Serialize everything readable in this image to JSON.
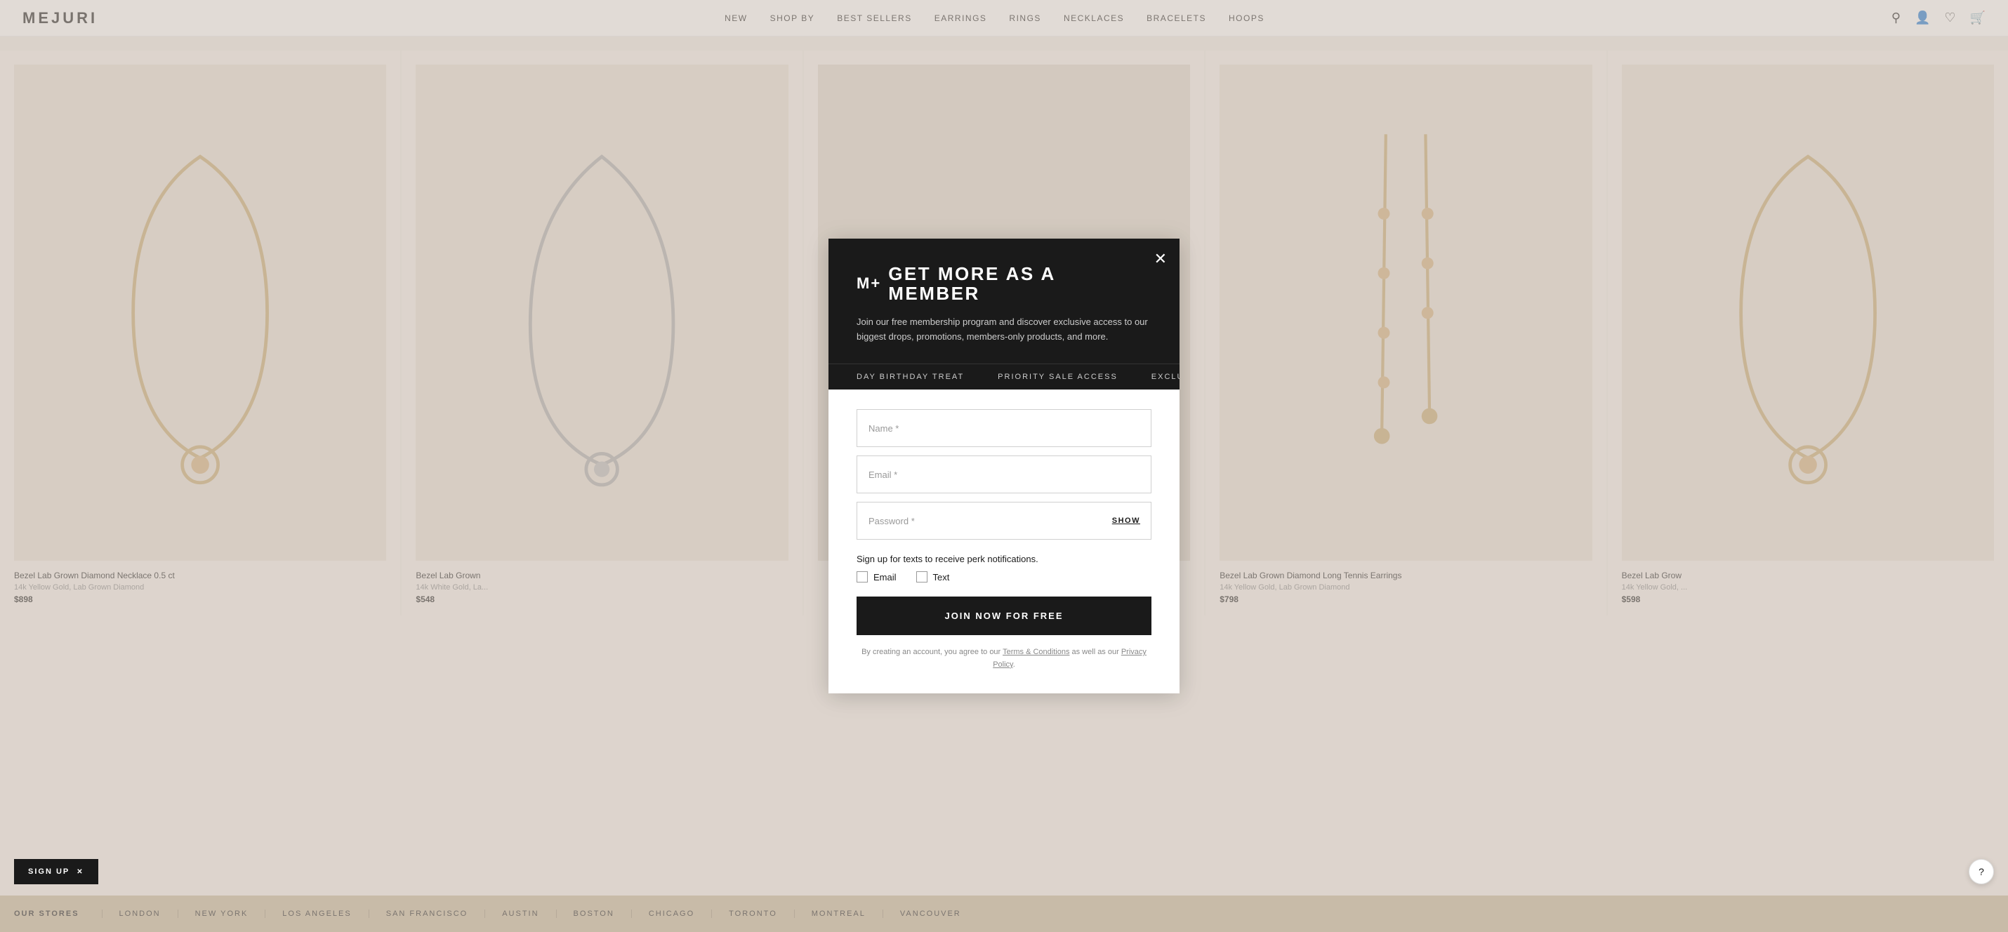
{
  "brand": {
    "logo": "MEJURI"
  },
  "nav": {
    "links": [
      "NEW",
      "SHOP BY",
      "BEST SELLERS",
      "EARRINGS",
      "RINGS",
      "NECKLACES",
      "BRACELETS",
      "HOOPS"
    ]
  },
  "modal": {
    "mplus": "M+",
    "title": "GET MORE AS A MEMBER",
    "subtitle": "Join our free membership program and discover exclusive access to our biggest drops, promotions, members-only products, and more.",
    "perks": [
      "DAY BIRTHDAY TREAT",
      "PRIORITY SALE ACCESS",
      "EXCLUSIVE PRO"
    ],
    "name_placeholder": "Name *",
    "email_placeholder": "Email *",
    "password_placeholder": "Password *",
    "show_label": "SHOW",
    "signup_text": "Sign up for texts to receive perk notifications.",
    "email_label": "Email",
    "text_label": "Text",
    "join_button": "JOIN NOW FOR FREE",
    "terms_prefix": "By creating an account, you agree to our ",
    "terms_link1": "Terms & Conditions",
    "terms_middle": " as well as our ",
    "terms_link2": "Privacy Policy",
    "terms_suffix": "."
  },
  "products": [
    {
      "name": "Bezel Lab Grown Diamond Necklace 0.5 ct",
      "sub": "14k Yellow Gold, Lab Grown Diamond",
      "price": "$898",
      "type": "necklace-yellow"
    },
    {
      "name": "Bezel Lab Grown",
      "sub": "14k White Gold, La...",
      "price": "$548",
      "type": "necklace-white"
    },
    {
      "name": "",
      "sub": "",
      "price": "",
      "type": "hidden"
    },
    {
      "name": "Bezel Lab Grown Diamond Long Tennis Earrings",
      "sub": "14k Yellow Gold, Lab Grown Diamond",
      "price": "$798",
      "type": "earrings"
    },
    {
      "name": "Bezel Lab Grow",
      "sub": "14k Yellow Gold, ...",
      "price": "$598",
      "type": "necklace-yellow2"
    }
  ],
  "stores": {
    "label": "OUR STORES",
    "locations": [
      "LONDON",
      "NEW YORK",
      "LOS ANGELES",
      "SAN FRANCISCO",
      "AUSTIN",
      "BOSTON",
      "CHICAGO",
      "TORONTO",
      "MONTREAL",
      "VANCOUVER"
    ]
  },
  "signup_pill": {
    "label": "SIGN UP",
    "close": "✕"
  },
  "help": {
    "icon": "?"
  }
}
